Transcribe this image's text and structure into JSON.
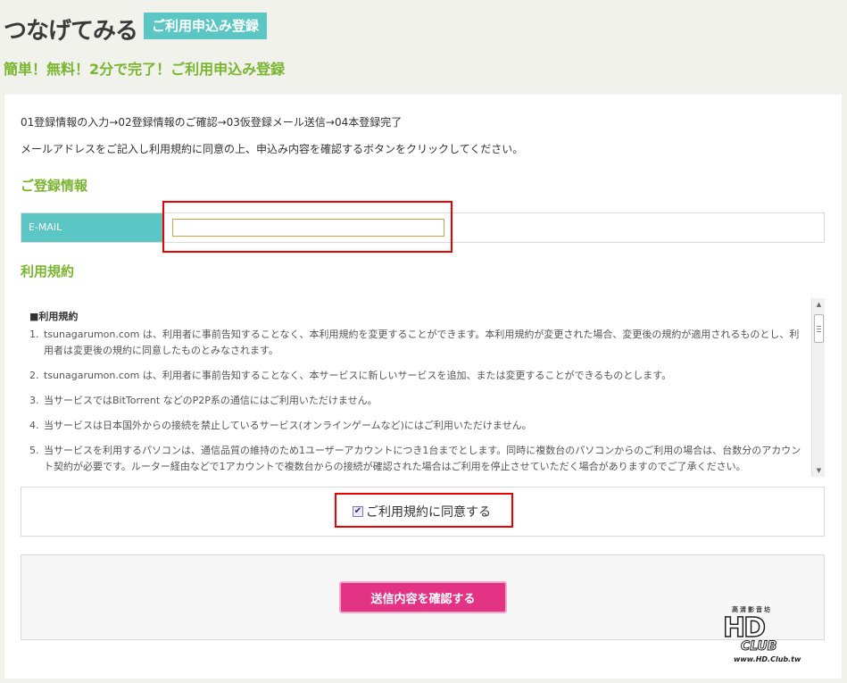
{
  "header": {
    "brand": "つなげてみる",
    "tag": "ご利用申込み登録",
    "subtitle": "簡単！無料！2分で完了！ご利用申込み登録"
  },
  "main": {
    "steps": "01登録情報の入力→02登録情報のご確認→03仮登録メール送信→04本登録完了",
    "instructions": "メールアドレスをご記入し利用規約に同意の上、申込み内容を確認するボタンをクリックしてください。",
    "registration_title": "ご登録情報",
    "email_label": "E-MAIL",
    "email_value": "",
    "terms_title": "利用規約",
    "terms": {
      "heading": "■利用規約",
      "items": [
        {
          "num": "1.",
          "text": "tsunagarumon.com は、利用者に事前告知することなく、本利用規約を変更することができます。本利用規約が変更された場合、変更後の規約が適用されるものとし、利用者は変更後の規約に同意したものとみなされます。"
        },
        {
          "num": "2.",
          "text": "tsunagarumon.com は、利用者に事前告知することなく、本サービスに新しいサービスを追加、または変更することができるものとします。"
        },
        {
          "num": "3.",
          "text": "当サービスではBitTorrent などのP2P系の通信にはご利用いただけません。"
        },
        {
          "num": "4.",
          "text": "当サービスは日本国外からの接続を禁止しているサービス(オンラインゲームなど)にはご利用いただけません。"
        },
        {
          "num": "5.",
          "text": "当サービスを利用するパソコンは、通信品質の維持のため1ユーザーアカウントにつき1台までとします。同時に複数台のパソコンからのご利用の場合は、台数分のアカウント契約が必要です。ルーター経由などで1アカウントで複数台からの接続が確認された場合はご利用を停止させていただく場合がありますのでご了承ください。"
        }
      ]
    },
    "agree_label": "ご利用規約に同意する",
    "agree_checked": true,
    "submit_label": "送信内容を確認する"
  },
  "watermark": {
    "top": "高清影音坊",
    "hd": "HD",
    "club": "CLUB",
    "url": "www.HD.Club.tw"
  },
  "colors": {
    "accent_teal": "#5cc6c4",
    "accent_green": "#7ab530",
    "submit_pink": "#e23385",
    "highlight_red": "#ee0000"
  }
}
